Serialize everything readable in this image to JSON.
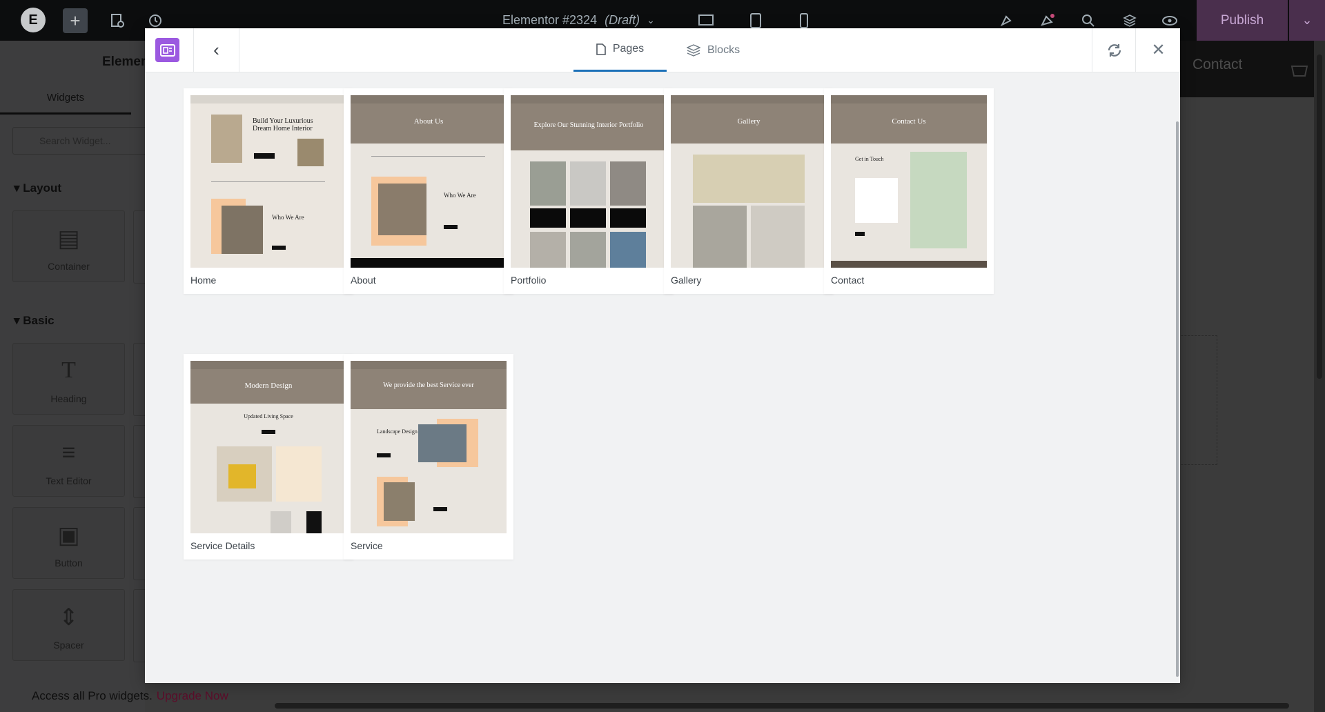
{
  "topbar": {
    "doc_title": "Elementor #2324",
    "doc_status": "(Draft)",
    "publish_label": "Publish"
  },
  "left_panel": {
    "title": "Elemen",
    "tab_widgets": "Widgets",
    "search_placeholder": "Search Widget...",
    "section_layout": "Layout",
    "section_basic": "Basic",
    "widgets": {
      "container": "Container",
      "heading": "Heading",
      "text_editor": "Text Editor",
      "button": "Button",
      "spacer": "Spacer"
    },
    "upgrade_text": "Access all Pro widgets.",
    "upgrade_link": "Upgrade Now"
  },
  "canvas": {
    "contact_text": "Contact"
  },
  "modal": {
    "tabs": [
      {
        "label": "Pages",
        "active": true
      },
      {
        "label": "Blocks",
        "active": false
      }
    ],
    "templates": [
      {
        "name": "Home",
        "thumb_heading": "Build Your Luxurious Dream Home Interior",
        "thumb_sub": "Who We Are"
      },
      {
        "name": "About",
        "thumb_heading": "About Us",
        "thumb_sub": "Who We Are"
      },
      {
        "name": "Portfolio",
        "thumb_heading": "Explore Our Stunning Interior Portfolio",
        "thumb_sub": ""
      },
      {
        "name": "Gallery",
        "thumb_heading": "Gallery",
        "thumb_sub": ""
      },
      {
        "name": "Contact",
        "thumb_heading": "Contact Us",
        "thumb_sub": "Get in Touch"
      },
      {
        "name": "Service Details",
        "thumb_heading": "Modern Design",
        "thumb_sub": "Updated Living Space"
      },
      {
        "name": "Service",
        "thumb_heading": "We provide the best Service ever",
        "thumb_sub": "Landscape Design"
      }
    ],
    "colors": {
      "accent": "#9b59e0",
      "tab_underline": "#1d71b8",
      "publish_bg": "#4a2f4d",
      "upgrade_link": "#5c0d2a"
    }
  }
}
